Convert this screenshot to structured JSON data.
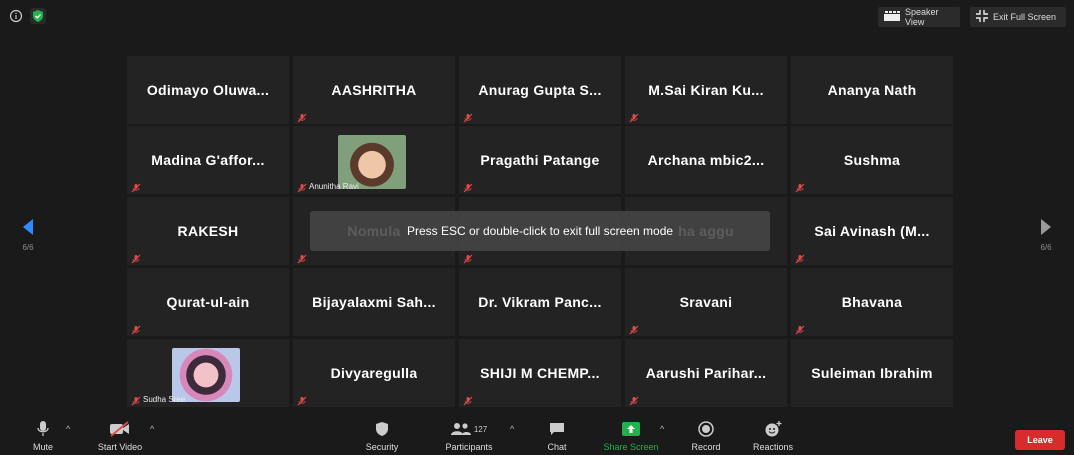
{
  "topbar": {
    "info_icon": "info-circle-icon",
    "shield_icon": "shield-check-icon",
    "shield_color": "#23b14d",
    "speaker_view_label": "Speaker View",
    "exit_full_screen_label": "Exit Full Screen"
  },
  "nav": {
    "left_page": "6/6",
    "right_page": "6/6",
    "accent": "#2d8cff"
  },
  "participants": [
    {
      "name": "Odimayo  Oluwa...",
      "muted": false
    },
    {
      "name": "AASHRITHA",
      "muted": true
    },
    {
      "name": "Anurag Gupta S...",
      "muted": true
    },
    {
      "name": "M.Sai Kiran Ku...",
      "muted": true
    },
    {
      "name": "Ananya Nath",
      "muted": false
    },
    {
      "name": "Madina G'affor...",
      "muted": true
    },
    {
      "name": "Anunitha Ravi",
      "muted": true,
      "photo": true
    },
    {
      "name": "Pragathi Patange",
      "muted": true
    },
    {
      "name": "Archana mbic2...",
      "muted": false
    },
    {
      "name": "Sushma",
      "muted": true
    },
    {
      "name": "RAKESH",
      "muted": true
    },
    {
      "name": "Nomula",
      "muted": true
    },
    {
      "name": "",
      "muted": true
    },
    {
      "name": "ha aggu",
      "muted": false
    },
    {
      "name": "Sai Avinash (M...",
      "muted": true
    },
    {
      "name": "Qurat-ul-ain",
      "muted": true
    },
    {
      "name": "Bijayalaxmi Sah...",
      "muted": false
    },
    {
      "name": "Dr. Vikram Panc...",
      "muted": false
    },
    {
      "name": "Sravani",
      "muted": true
    },
    {
      "name": "Bhavana",
      "muted": true
    },
    {
      "name": "Sudha Sree",
      "muted": true,
      "photo": true
    },
    {
      "name": "Divyaregulla",
      "muted": true
    },
    {
      "name": "SHIJI M CHEMP...",
      "muted": true
    },
    {
      "name": "Aarushi  Parihar...",
      "muted": true
    },
    {
      "name": "Suleiman Ibrahim",
      "muted": false
    }
  ],
  "toast": {
    "text": "Press ESC or double-click to exit full screen mode"
  },
  "toolbar": {
    "mute_label": "Mute",
    "start_video_label": "Start Video",
    "security_label": "Security",
    "participants_label": "Participants",
    "participants_count": "127",
    "chat_label": "Chat",
    "share_screen_label": "Share Screen",
    "record_label": "Record",
    "reactions_label": "Reactions",
    "leave_label": "Leave",
    "share_color": "#23b14d",
    "leave_color": "#d92b2b"
  }
}
